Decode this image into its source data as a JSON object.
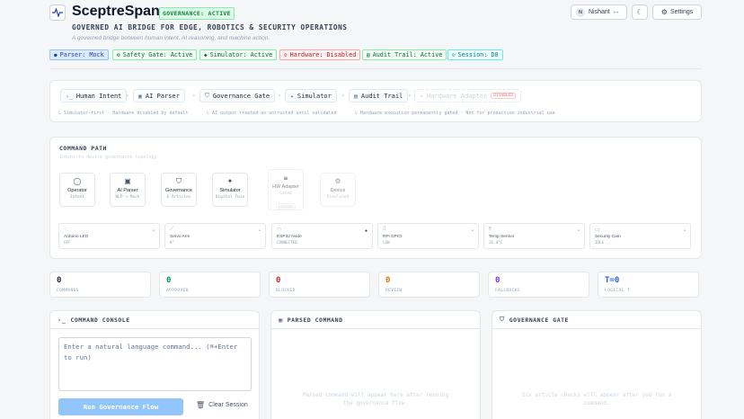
{
  "header": {
    "title": "SceptreSpan",
    "status_badge": "GOVERNANCE: ACTIVE",
    "subtitle": "GOVERNED AI BRIDGE FOR EDGE, ROBOTICS & SECURITY OPERATIONS",
    "tagline": "A governed bridge between human intent, AI reasoning, and machine action.",
    "user": {
      "initial": "N",
      "name": "Nishant"
    },
    "settings_label": "Settings"
  },
  "status_pills": [
    {
      "label": "Parser: Mock"
    },
    {
      "label": "Safety Gate: Active"
    },
    {
      "label": "Simulator: Active"
    },
    {
      "label": "Hardware: Disabled"
    },
    {
      "label": "Audit Trail: Active"
    },
    {
      "label": "Session: D8"
    }
  ],
  "pipeline": {
    "steps": [
      {
        "label": "Human Intent",
        "icon": ">_"
      },
      {
        "label": "AI Parser",
        "icon": "cpu-icon"
      },
      {
        "label": "Governance Gate",
        "icon": "shield-icon"
      },
      {
        "label": "Simulator",
        "icon": "sparkle-icon"
      },
      {
        "label": "Audit Trail",
        "icon": "doc-icon"
      },
      {
        "label": "Hardware Adapter",
        "icon": "plug-icon",
        "badge": "DISABLED"
      }
    ],
    "notes": [
      "Simulator-first · Hardware disabled by default",
      "AI output treated as untrusted until validated",
      "Hardware execution permanently gated · Not for production industrial use"
    ]
  },
  "command_path": {
    "title": "COMMAND PATH",
    "subtitle": "Intent-to-device governance topology",
    "nodes": [
      {
        "title": "Operator",
        "sub": "Intent"
      },
      {
        "title": "AI Parser",
        "sub": "NLP → Mock"
      },
      {
        "title": "Governance",
        "sub": "6 Articles"
      },
      {
        "title": "Simulator",
        "sub": "Digital Twin"
      },
      {
        "title": "HW Adapter",
        "sub": "Gated",
        "tag": "LOCKED"
      },
      {
        "title": "Device",
        "sub": "Simulated"
      }
    ],
    "devices": [
      {
        "name": "Arduino LED",
        "state": "OFF"
      },
      {
        "name": "Servo Arm",
        "state": "0°"
      },
      {
        "name": "ESP32 Node",
        "state": "CONNECTED"
      },
      {
        "name": "RPi GPIO",
        "state": "LOW"
      },
      {
        "name": "Temp Sensor",
        "state": "26.4°C"
      },
      {
        "name": "Security Cam",
        "state": "IDLE"
      }
    ]
  },
  "stats": [
    {
      "value": "0",
      "label": "COMMANDS",
      "color": "#1e293b"
    },
    {
      "value": "0",
      "label": "APPROVED",
      "color": "#059669"
    },
    {
      "value": "0",
      "label": "BLOCKED",
      "color": "#dc2626"
    },
    {
      "value": "0",
      "label": "REVIEW",
      "color": "#d97706"
    },
    {
      "value": "0",
      "label": "FALLBACKS",
      "color": "#7c3aed"
    },
    {
      "value": "T=0",
      "label": "LOGICAL T",
      "color": "#2563eb"
    }
  ],
  "console": {
    "title": "COMMAND CONSOLE",
    "placeholder": "Enter a natural language command... (⌘+Enter to run)",
    "run_label": "Run Governance Flow",
    "clear_label": "Clear Session"
  },
  "parsed": {
    "title": "PARSED COMMAND",
    "empty": "Parsed command will appear here after running the governance flow."
  },
  "gate": {
    "title": "GOVERNANCE GATE",
    "empty": "Six article checks will appear after you run a command."
  }
}
